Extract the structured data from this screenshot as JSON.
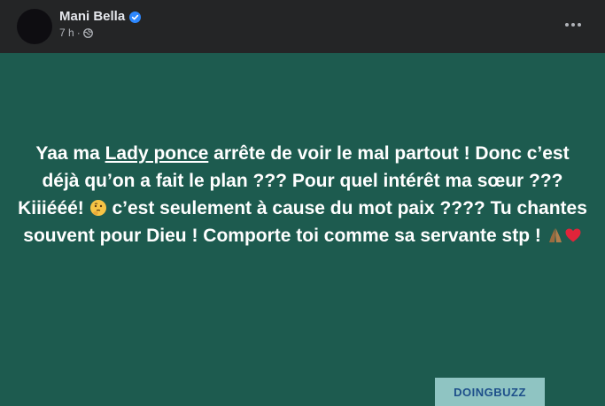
{
  "post": {
    "author": "Mani Bella",
    "time": "7 h",
    "separator": "·",
    "text_before_mention": "Yaa ma ",
    "mention": "Lady ponce",
    "text_after_mention": " arrête de voir le mal partout ! Donc c’est déjà qu’on a fait le plan ??? Pour quel intérêt ma sœur ??? Kiiiééé! ",
    "text_after_emoji": " c’est seulement à cause du mot paix ???? Tu chantes souvent pour Dieu ! Comporte toi comme sa servante stp ! ",
    "emojis": [
      "thinking-face-icon",
      "folded-hands-icon",
      "red-heart-icon"
    ]
  },
  "watermark": {
    "text": "DOINGBUZZ"
  },
  "colors": {
    "header_bg": "#242526",
    "post_bg": "#1d5b4f",
    "verified": "#2d88ff",
    "text": "#ffffff"
  }
}
